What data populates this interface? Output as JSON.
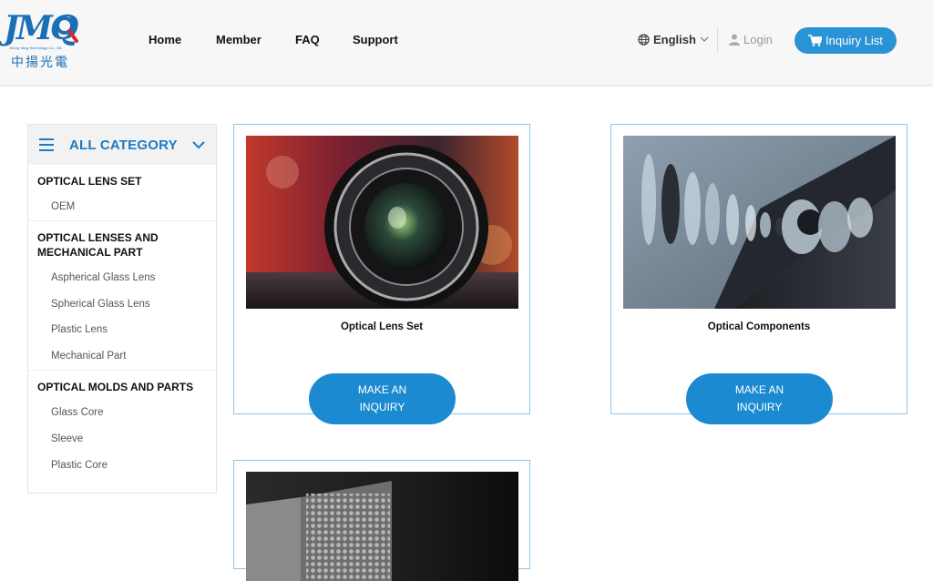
{
  "brand": {
    "logo_mark": "JMQ",
    "logo_tagline": "Jhong Yang Technology Co., Ltd.",
    "logo_cn": "中揚光電"
  },
  "nav": {
    "home": "Home",
    "member": "Member",
    "faq": "FAQ",
    "support": "Support"
  },
  "header_actions": {
    "language": "English",
    "login": "Login",
    "inquiry_list": "Inquiry List"
  },
  "colors": {
    "accent": "#1b8ad1",
    "category_blue": "#1e7bc4",
    "card_border": "#8ec4e8"
  },
  "sidebar": {
    "title": "ALL CATEGORY",
    "sections": [
      {
        "title": "OPTICAL LENS SET",
        "items": [
          "OEM"
        ]
      },
      {
        "title": "OPTICAL LENSES AND MECHANICAL PART",
        "items": [
          "Aspherical Glass Lens",
          "Spherical Glass Lens",
          "Plastic Lens",
          "Mechanical Part"
        ]
      },
      {
        "title": "OPTICAL MOLDS AND PARTS",
        "items": [
          "Glass Core",
          "Sleeve",
          "Plastic Core"
        ]
      }
    ]
  },
  "cards": [
    {
      "title": "Optical Lens Set",
      "button": "MAKE AN INQUIRY"
    },
    {
      "title": "Optical Components",
      "button": "MAKE AN INQUIRY"
    },
    {
      "title": "",
      "button": ""
    }
  ]
}
